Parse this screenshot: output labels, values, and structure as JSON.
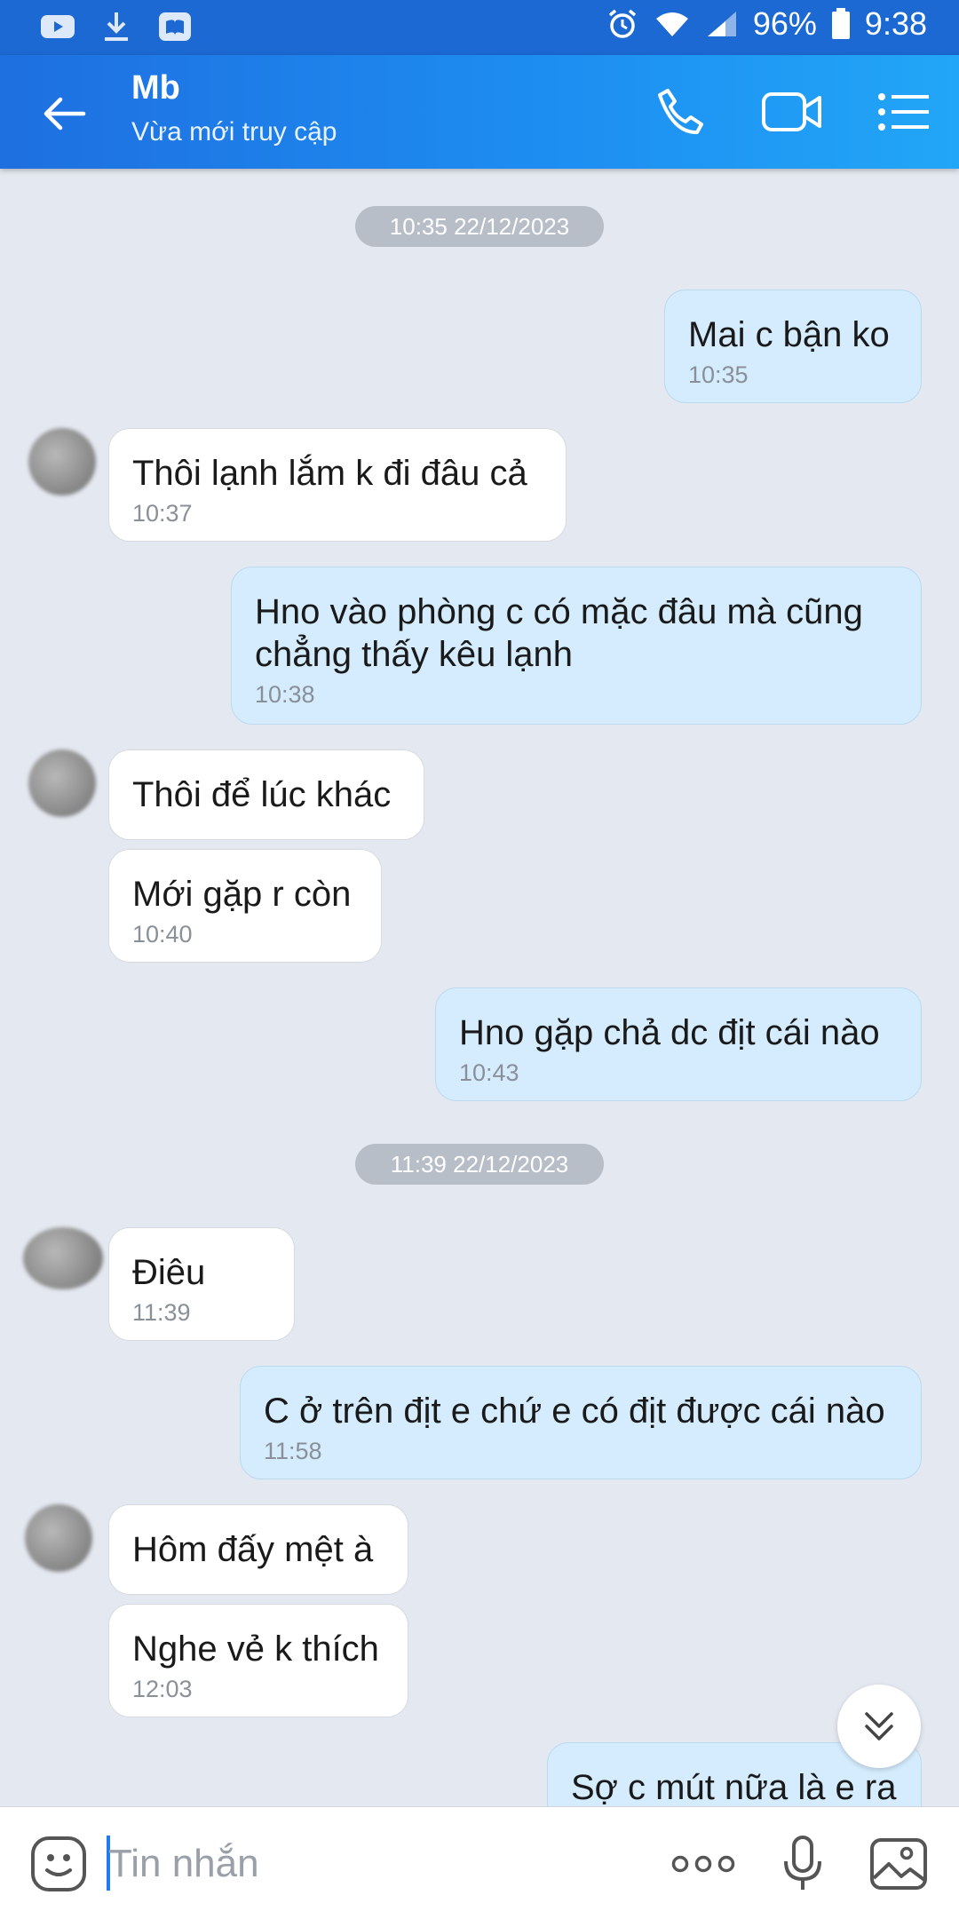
{
  "status_bar": {
    "battery": "96%",
    "time": "9:38"
  },
  "header": {
    "title": "Mb",
    "subtitle": "Vừa mới truy cập"
  },
  "messages": [
    {
      "type": "timestamp",
      "text": "10:35 22/12/2023"
    },
    {
      "type": "out",
      "text": "Mai c bận ko",
      "time": "10:35"
    },
    {
      "type": "in",
      "text": "Thôi lạnh lắm k đi đâu cả",
      "time": "10:37"
    },
    {
      "type": "out",
      "text": "Hno vào phòng c có mặc đâu mà cũng chẳng thấy kêu lạnh",
      "time": "10:38"
    },
    {
      "type": "in",
      "text": "Thôi để lúc khác"
    },
    {
      "type": "in",
      "text": "Mới gặp r còn",
      "time": "10:40"
    },
    {
      "type": "out",
      "text": "Hno gặp chả dc địt cái nào",
      "time": "10:43"
    },
    {
      "type": "timestamp",
      "text": "11:39 22/12/2023"
    },
    {
      "type": "in",
      "text": "Điêu",
      "time": "11:39"
    },
    {
      "type": "out",
      "text": "C ở trên địt e chứ e có địt được cái nào",
      "time": "11:58"
    },
    {
      "type": "in",
      "text": "Hôm đấy mệt à"
    },
    {
      "type": "in",
      "text": "Nghe vẻ k thích",
      "time": "12:03"
    },
    {
      "type": "out",
      "text": "Sợ c mút nữa là e ra"
    }
  ],
  "input": {
    "placeholder": "Tin nhắn"
  },
  "colors": {
    "header_gradient_start": "#1e6fe0",
    "header_gradient_end": "#22a6f7",
    "outgoing_bubble": "#d4ecfd",
    "incoming_bubble": "#ffffff",
    "chat_background": "#e4e8f0"
  }
}
